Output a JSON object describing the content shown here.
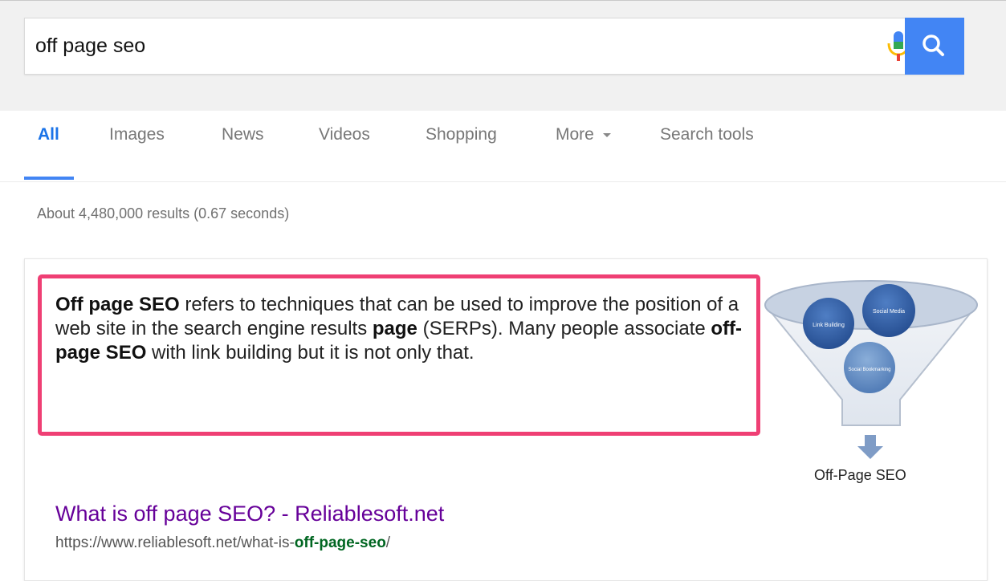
{
  "search": {
    "query": "off page seo"
  },
  "tabs": [
    {
      "label": "All",
      "active": true
    },
    {
      "label": "Images"
    },
    {
      "label": "News"
    },
    {
      "label": "Videos"
    },
    {
      "label": "Shopping"
    },
    {
      "label": "More"
    },
    {
      "label": "Search tools"
    }
  ],
  "results_stats": "About 4,480,000 results (0.67 seconds)",
  "featured_snippet": {
    "p1_bold": "Off page SEO",
    "p1_text": " refers to techniques that can be used to improve the position of a web site in the search engine results ",
    "p2_bold": "page",
    "p2_text": " (SERPs). Many people associate ",
    "p3_bold": "off-page SEO",
    "p3_text": " with link building but it is not only that.",
    "image": {
      "bubbles": [
        "Link Building",
        "Social Media",
        "Social Bookmarking"
      ],
      "caption": "Off-Page SEO"
    },
    "result": {
      "title": "What is off page SEO? - Reliablesoft.net",
      "url_prefix": "https://www.reliablesoft.net/what-is-",
      "url_bold": "off-page-seo",
      "url_suffix": "/"
    }
  },
  "colors": {
    "accent": "#4285f4",
    "highlight": "#ef3f74",
    "visited_link": "#660099",
    "url_green": "#006621"
  },
  "icons": {
    "mic": "microphone-icon",
    "search": "magnifier-icon",
    "more": "caret-down-icon"
  }
}
